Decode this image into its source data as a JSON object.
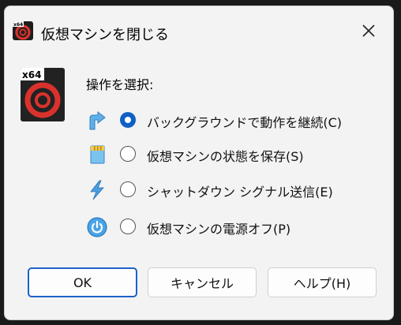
{
  "window": {
    "title": "仮想マシンを閉じる",
    "icon": "virtualbox-x64-icon",
    "app_badge": "x64"
  },
  "prompt": "操作を選択:",
  "options": [
    {
      "label": "バックグラウンドで動作を継続(C)",
      "icon": "background-arrow-icon",
      "checked": true
    },
    {
      "label": "仮想マシンの状態を保存(S)",
      "icon": "save-state-icon",
      "checked": false
    },
    {
      "label": "シャットダウン シグナル送信(E)",
      "icon": "lightning-icon",
      "checked": false
    },
    {
      "label": "仮想マシンの電源オフ(P)",
      "icon": "power-icon",
      "checked": false
    }
  ],
  "buttons": {
    "ok": "OK",
    "cancel": "キャンセル",
    "help": "ヘルプ(H)"
  },
  "colors": {
    "accent": "#0f5fc6",
    "dialog_bg": "#f3f3f3",
    "outer_bg": "#1a1a1a"
  }
}
